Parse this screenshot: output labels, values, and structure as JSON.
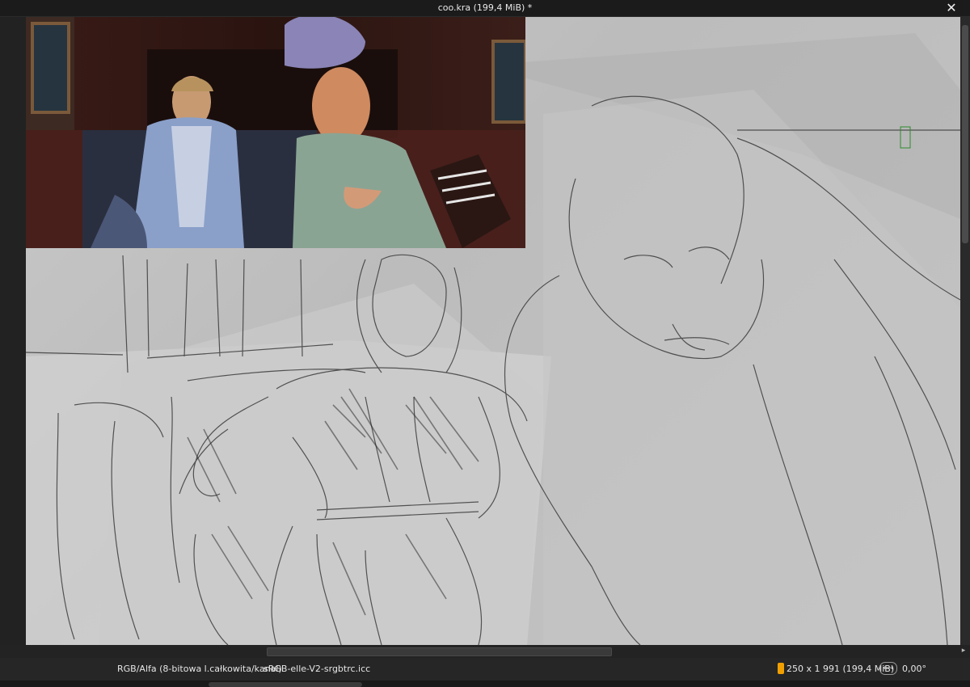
{
  "window": {
    "title": "coo.kra (199,4 MiB) *",
    "close_glyph": "✕"
  },
  "canvas": {
    "reference_image": "film-still-reference",
    "sketch": "pencil-figure-sketch"
  },
  "status": {
    "color_model": "RGB/Alfa (8-bitowa l.całkowita/kanał)",
    "profile": "sRGB-elle-V2-srgbtrc.icc",
    "image_size": "250 x 1 991 (199,4 MiB)",
    "rotation": "0,00°",
    "size_icon": "memory-icon",
    "rotation_icon": "rotate-icon",
    "size_icon_color": "#f0a000"
  },
  "scroll": {
    "right_arrow": "▸"
  }
}
